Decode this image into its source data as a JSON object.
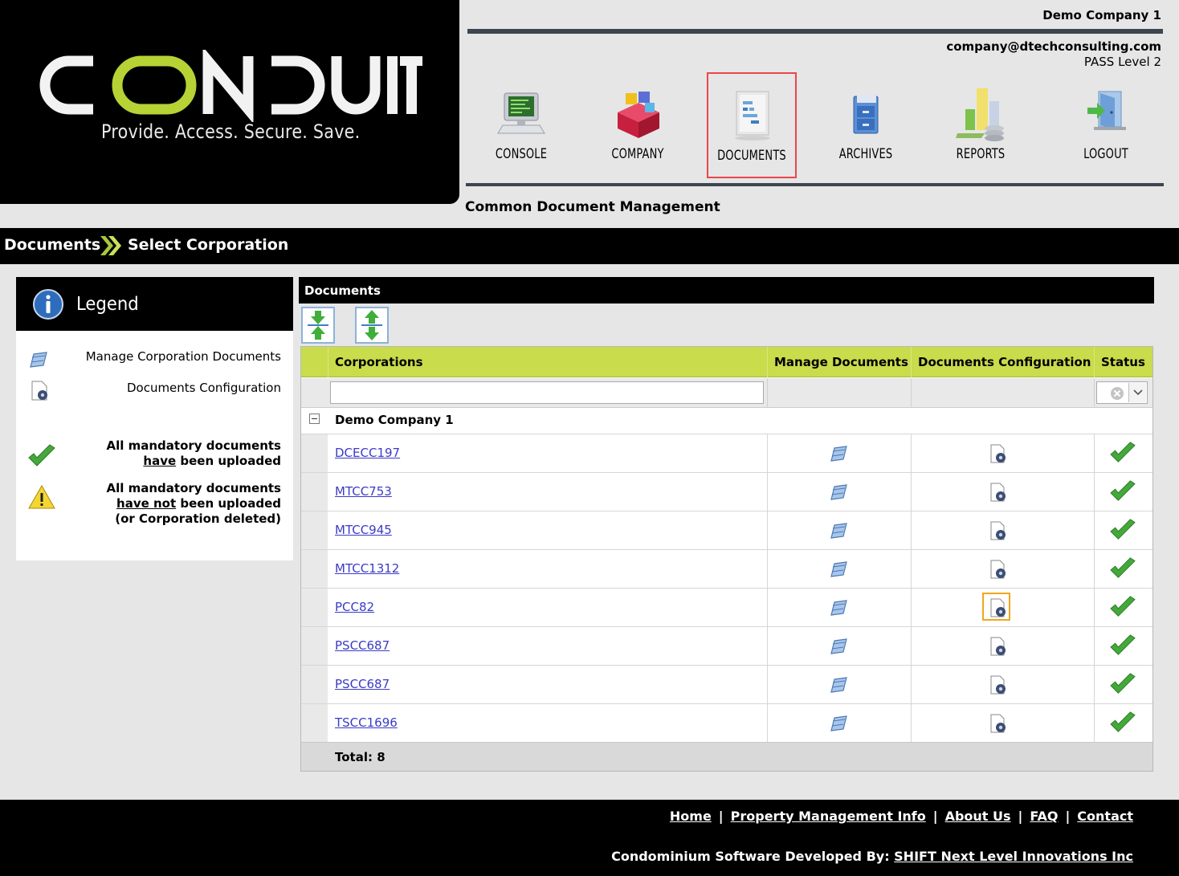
{
  "brand": {
    "logo_text": "CONDUIT",
    "tagline": "Provide. Access. Secure. Save."
  },
  "account": {
    "company": "Demo Company 1",
    "email": "company@dtechconsulting.com",
    "pass_level": "PASS Level 2"
  },
  "nav": [
    {
      "label": "CONSOLE",
      "icon": "console-icon"
    },
    {
      "label": "COMPANY",
      "icon": "company-icon"
    },
    {
      "label": "DOCUMENTS",
      "icon": "documents-icon",
      "active": true
    },
    {
      "label": "ARCHIVES",
      "icon": "archives-icon"
    },
    {
      "label": "REPORTS",
      "icon": "reports-icon"
    },
    {
      "label": "LOGOUT",
      "icon": "logout-icon"
    }
  ],
  "page_subtitle": "Common Document Management",
  "breadcrumb": {
    "root": "Documents",
    "current": "Select Corporation"
  },
  "legend": {
    "title": "Legend",
    "items": [
      {
        "icon": "manage-documents-icon",
        "text": "Manage Corporation Documents"
      },
      {
        "icon": "documents-configuration-icon",
        "text": "Documents Configuration"
      }
    ],
    "status_ok": {
      "line1": "All mandatory documents",
      "underlined": "have",
      "rest": " been uploaded"
    },
    "status_warn": {
      "line1": "All mandatory documents",
      "underlined": "have not",
      "rest": " been uploaded",
      "line3": "(or Corporation deleted)"
    }
  },
  "documents": {
    "panel_title": "Documents",
    "toolbar": [
      "expand-all-icon",
      "collapse-all-icon"
    ],
    "columns": [
      "Corporations",
      "Manage Documents",
      "Documents Configuration",
      "Status"
    ],
    "filter": {
      "corporation_value": "",
      "corporation_placeholder": ""
    },
    "group": "Demo Company 1",
    "rows": [
      {
        "corporation": "DCECC197",
        "status": "uploaded"
      },
      {
        "corporation": "MTCC753",
        "status": "uploaded"
      },
      {
        "corporation": "MTCC945",
        "status": "uploaded"
      },
      {
        "corporation": "MTCC1312",
        "status": "uploaded"
      },
      {
        "corporation": "PCC82",
        "status": "uploaded",
        "highlighted": true
      },
      {
        "corporation": "PSCC687",
        "status": "uploaded"
      },
      {
        "corporation": "PSCC687",
        "status": "uploaded"
      },
      {
        "corporation": "TSCC1696",
        "status": "uploaded"
      }
    ],
    "total_label": "Total: 8"
  },
  "footer": {
    "links": [
      "Home",
      "Property Management Info",
      "About Us",
      "FAQ",
      "Contact"
    ],
    "credit_prefix": "Condominium Software Developed By: ",
    "credit_link": "SHIFT Next Level Innovations Inc"
  },
  "colors": {
    "header_bar": "#000000",
    "grid_header": "#c8dc4c",
    "logo_accent": "#b6d234",
    "active_nav_border": "#e8474d",
    "highlight_border": "#f0a61f",
    "link": "#3b3bc8"
  }
}
